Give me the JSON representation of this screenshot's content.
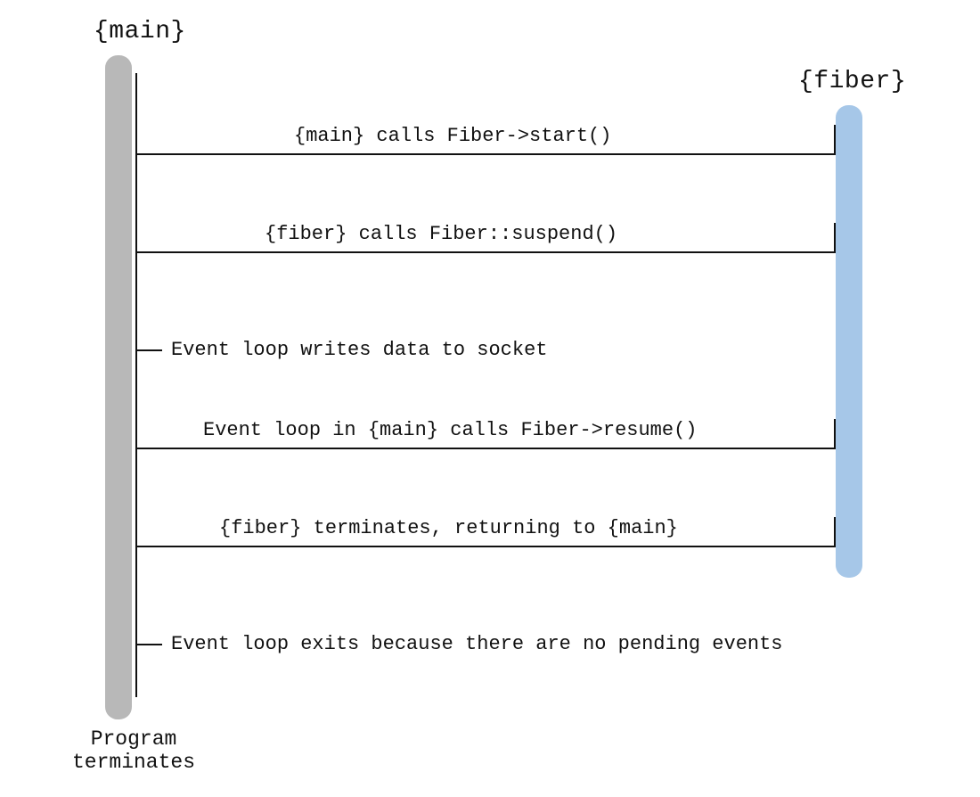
{
  "lifelines": {
    "main": {
      "title": "{main}"
    },
    "fiber": {
      "title": "{fiber}"
    }
  },
  "messages": {
    "m1": "{main} calls Fiber->start()",
    "m2": "{fiber} calls Fiber::suspend()",
    "m3": "Event loop writes data to socket",
    "m4": "Event loop in {main} calls Fiber->resume()",
    "m5": "{fiber} terminates, returning to {main}",
    "m6": "Event loop exits because there are no pending events"
  },
  "footer": "Program\nterminates",
  "colors": {
    "main_bar": "#b8b8b8",
    "fiber_bar": "#a6c7e8",
    "line": "#111111"
  }
}
